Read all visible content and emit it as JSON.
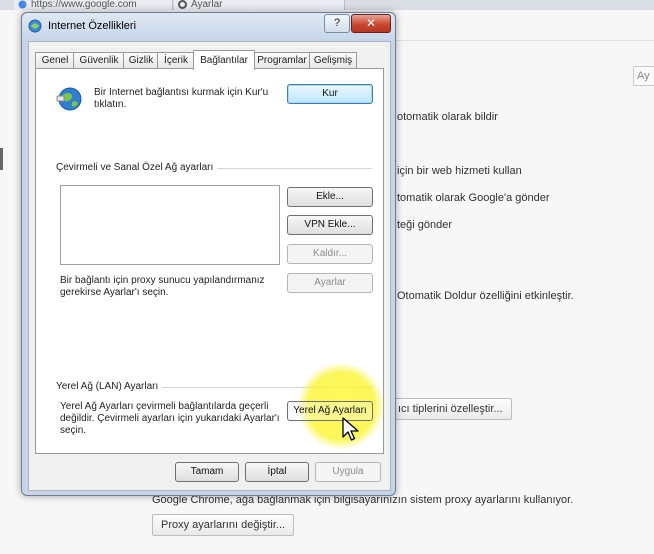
{
  "browser": {
    "tab1_title": "https://www.google.com",
    "tab2_title": "Ayarlar",
    "search_placeholder": "Ay"
  },
  "background_settings": {
    "lines": [
      "otomatik olarak bildir",
      "için bir web hizmeti kullan",
      "tomatik olarak Google'a gönder",
      "teği gönder",
      "Otomatik Doldur özelliğini etkinleştir."
    ],
    "customize_button": "ıcı tiplerini özelleştir...",
    "proxy_note": "Google Chrome, ağa bağlanmak için bilgisayarınızın sistem proxy ayarlarını kullanıyor.",
    "proxy_button": "Proxy ayarlarını değiştir..."
  },
  "dialog": {
    "title": "Internet Özellikleri",
    "help_label": "?",
    "close_label": "✕",
    "tabs": [
      "Genel",
      "Güvenlik",
      "Gizlik",
      "İçerik",
      "Bağlantılar",
      "Programlar",
      "Gelişmiş"
    ],
    "active_tab": "Bağlantılar",
    "setup_text_line1": "Bir Internet bağlantısı kurmak için Kur'u",
    "setup_text_line2": "tıklatın.",
    "setup_button": "Kur",
    "dialup_group": "Çevirmeli ve Sanal Özel Ağ ayarları",
    "add_button": "Ekle...",
    "add_vpn_button": "VPN Ekle...",
    "remove_button": "Kaldır...",
    "settings_button": "Ayarlar",
    "proxy_text_line1": "Bir bağlantı için proxy sunucu yapılandırmanız",
    "proxy_text_line2": "gerekirse Ayarlar'ı seçin.",
    "lan_group": "Yerel Ağ (LAN) Ayarları",
    "lan_text_line1": "Yerel Ağ Ayarları çevirmeli bağlantılarda geçerli",
    "lan_text_line2": "değildir. Çevirmeli ayarları için yukarıdaki Ayarlar'ı",
    "lan_text_line3": "seçin.",
    "lan_button": "Yerel Ağ Ayarları",
    "ok_button": "Tamam",
    "cancel_button": "İptal",
    "apply_button": "Uygula"
  },
  "colors": {
    "dialog_frame": "#c6d4e6",
    "highlight": "#fff63c",
    "close_button": "#c9462f"
  }
}
